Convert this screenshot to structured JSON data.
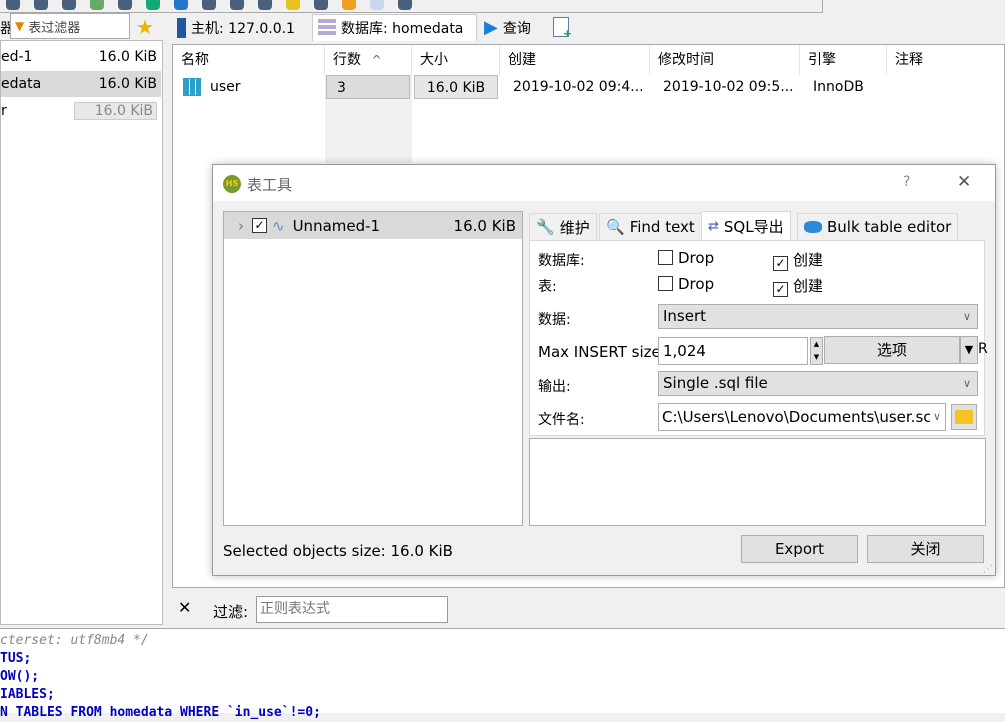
{
  "left_panel": {
    "filter_label_partial": "器",
    "filter_placeholder": "表过滤器",
    "items": [
      {
        "name": "ed-1",
        "size": "16.0 KiB"
      },
      {
        "name": "edata",
        "size": "16.0 KiB"
      },
      {
        "name": "r",
        "size": "16.0 KiB"
      }
    ]
  },
  "tabs": [
    {
      "label": "主机: 127.0.0.1"
    },
    {
      "label": "数据库: homedata"
    },
    {
      "label": "查询"
    }
  ],
  "table": {
    "columns": [
      "名称",
      "行数",
      "大小",
      "创建",
      "修改时间",
      "引擎",
      "注释"
    ],
    "sort_indicator": "^",
    "rows": [
      {
        "name": "user",
        "rows": "3",
        "size": "16.0 KiB",
        "created": "2019-10-02 09:4...",
        "modified": "2019-10-02 09:5...",
        "engine": "InnoDB",
        "comment": ""
      }
    ]
  },
  "dialog": {
    "title": "表工具",
    "help": "?",
    "close": "✕",
    "tree": {
      "name": "Unnamed-1",
      "size": "16.0 KiB",
      "checked": true
    },
    "tabs": [
      "维护",
      "Find text",
      "SQL导出",
      "Bulk table editor"
    ],
    "active_tab": "SQL导出",
    "form": {
      "database_label": "数据库:",
      "table_label": "表:",
      "drop": "Drop",
      "create": "创建",
      "db_drop": false,
      "db_create": true,
      "tbl_drop": false,
      "tbl_create": true,
      "data_label": "数据:",
      "data_value": "Insert",
      "max_insert_label": "Max INSERT size:",
      "max_insert_value": "1,024",
      "options_button": "选项",
      "options_extra": "R",
      "output_label": "输出:",
      "output_value": "Single .sql file",
      "filename_label": "文件名:",
      "filename_value": "C:\\Users\\Lenovo\\Documents\\user.sc"
    },
    "selected_size": "Selected objects size: 16.0 KiB",
    "export_button": "Export",
    "close_button": "关闭"
  },
  "filter_bar": {
    "label": "过滤:",
    "placeholder": "正则表达式"
  },
  "sql_log": [
    "cterset: utf8mb4 */",
    "TUS;",
    "OW();",
    "IABLES;",
    "N TABLES FROM homedata WHERE `in_use`!=0;"
  ]
}
